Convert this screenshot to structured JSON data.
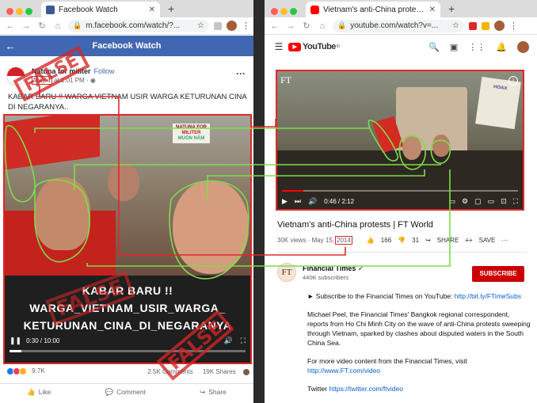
{
  "left_window": {
    "tab_title": "Facebook Watch",
    "url": "m.facebook.com/watch/?...",
    "header_title": "Facebook Watch",
    "post": {
      "author": "Natuna for militer",
      "follow": "Follow",
      "date_day": "May 4",
      "date_rest": "at 1:01 PM · ",
      "text": "KABAR BARU !! WARGA VIETNAM USIR WARGA KETURUNAN CINA DI NEGARANYA..",
      "video_watermark_line1": "NATUNA FOR",
      "video_watermark_line2": "MILITER",
      "video_sign": "MUÔN NĂM",
      "video_caption_line1": "KABAR BARU !!",
      "video_caption_line2": "WARGA_VIETNAM_USIR_WARGA_",
      "video_caption_line3": "KETURUNAN_CINA_DI_NEGARANYA",
      "video_time": "0:30 / 10:00",
      "video_progress": 0.05,
      "reactions_count": "9.7K",
      "comments": "2.5K Comments",
      "shares": "19K Shares",
      "like_label": "Like",
      "comment_label": "Comment",
      "share_label": "Share"
    },
    "stamp_text": "FALSE"
  },
  "right_window": {
    "tab_title": "Vietnam's anti-China protests",
    "url": "youtube.com/watch?v=...",
    "logo_text": "YouTube",
    "logo_sup": "ID",
    "video": {
      "channel_mark": "FT",
      "sign_text": "HOAX",
      "time": "0:46 / 2:12",
      "progress": 0.09,
      "title": "Vietnam's anti-China protests | FT World",
      "views": "30K views · May 15,",
      "year": "2014",
      "likes": "166",
      "dislikes": "31",
      "share": "SHARE",
      "save": "SAVE"
    },
    "channel": {
      "avatar_text": "FT",
      "name": "Financial Times",
      "subscribers": "440K subscribers",
      "subscribe_label": "SUBSCRIBE"
    },
    "description": {
      "p1_text": "► Subscribe to the Financial Times on YouTube: ",
      "p1_link": "http://bit.ly/FTimeSubs",
      "p2": "Michael Peel, the Financial Times' Bangkok regional correspondent, reports from Ho Chi Minh City on the wave of anti-China protests sweeping through Vietnam, sparked by clashes about disputed waters in the South China Sea.",
      "p3_text": "For more video content from the Financial Times, visit ",
      "p3_link": "http://www.FT.com/video",
      "p4_text": "Twitter ",
      "p4_link": "https://twitter.com/ftvideo"
    }
  },
  "colors": {
    "facebook_blue": "#4267b2",
    "youtube_red": "#ff0000",
    "subscribe_red": "#cc0000",
    "annotation_red": "#e0282a",
    "annotation_green": "#7ddc4a",
    "stamp_red": "#d22626"
  },
  "icons": [
    "back-arrow-icon",
    "forward-arrow-icon",
    "reload-icon",
    "home-icon",
    "lock-icon",
    "star-icon",
    "more-icon",
    "hamburger-menu-icon",
    "search-icon",
    "camera-icon",
    "apps-grid-icon",
    "bell-icon",
    "play-icon",
    "volume-icon",
    "fullscreen-icon",
    "like-icon",
    "dislike-icon",
    "share-icon",
    "save-icon",
    "comment-icon"
  ]
}
